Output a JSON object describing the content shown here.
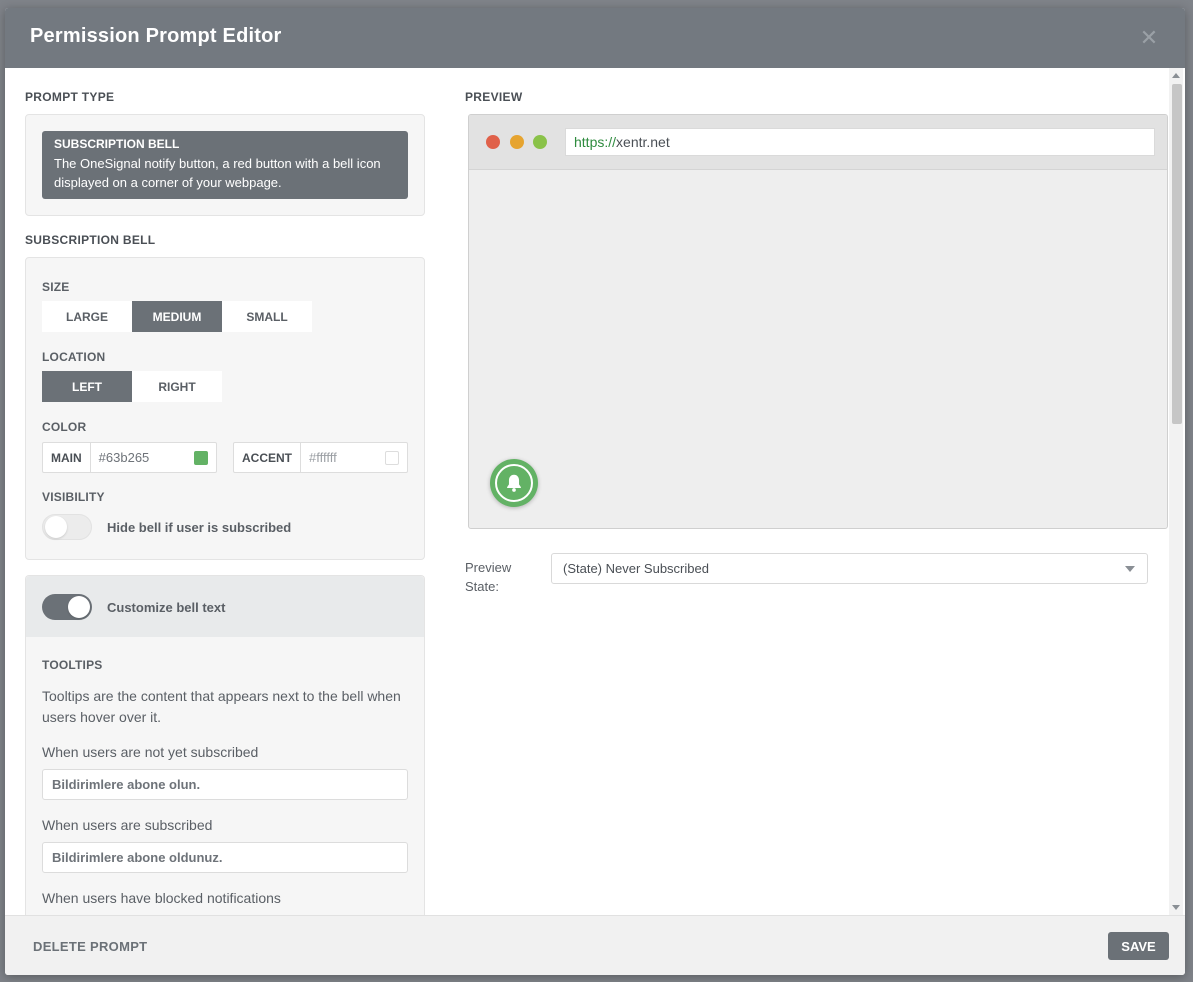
{
  "modal": {
    "title": "Permission Prompt Editor",
    "close_glyph": "✕"
  },
  "prompt_type": {
    "section_label": "PROMPT TYPE",
    "card_name": "SUBSCRIPTION BELL",
    "card_desc": "The OneSignal notify button, a red button with a bell icon displayed on a corner of your webpage."
  },
  "subscription_bell": {
    "section_label": "SUBSCRIPTION BELL",
    "size": {
      "label": "SIZE",
      "options": [
        "LARGE",
        "MEDIUM",
        "SMALL"
      ],
      "selected": "MEDIUM"
    },
    "location": {
      "label": "LOCATION",
      "options": [
        "LEFT",
        "RIGHT"
      ],
      "selected": "LEFT"
    },
    "color": {
      "label": "COLOR",
      "main_tag": "MAIN",
      "main_value": "#63b265",
      "accent_tag": "ACCENT",
      "accent_value": "#ffffff"
    },
    "visibility": {
      "label": "VISIBILITY",
      "toggle_label": "Hide bell if user is subscribed",
      "enabled": false
    }
  },
  "customize": {
    "toggle_label": "Customize bell text",
    "enabled": true,
    "tooltips_label": "TOOLTIPS",
    "tooltips_desc": "Tooltips are the content that appears next to the bell when users hover over it.",
    "not_subscribed_label": "When users are not yet subscribed",
    "not_subscribed_value": "Bildirimlere abone olun.",
    "subscribed_label": "When users are subscribed",
    "subscribed_value": "Bildirimlere abone oldunuz.",
    "blocked_label": "When users have blocked notifications"
  },
  "preview": {
    "section_label": "PREVIEW",
    "url_scheme": "https://",
    "url_host": "xentr.net",
    "state_label": "Preview State:",
    "state_value": "(State) Never Subscribed",
    "bell_color": "#63b265"
  },
  "footer": {
    "delete_label": "DELETE PROMPT",
    "save_label": "SAVE"
  },
  "colors": {
    "header": "#737980",
    "active_segment": "#6b7177",
    "traffic_red": "#e0614a",
    "traffic_yellow": "#e6a430",
    "traffic_green": "#8ac249"
  }
}
